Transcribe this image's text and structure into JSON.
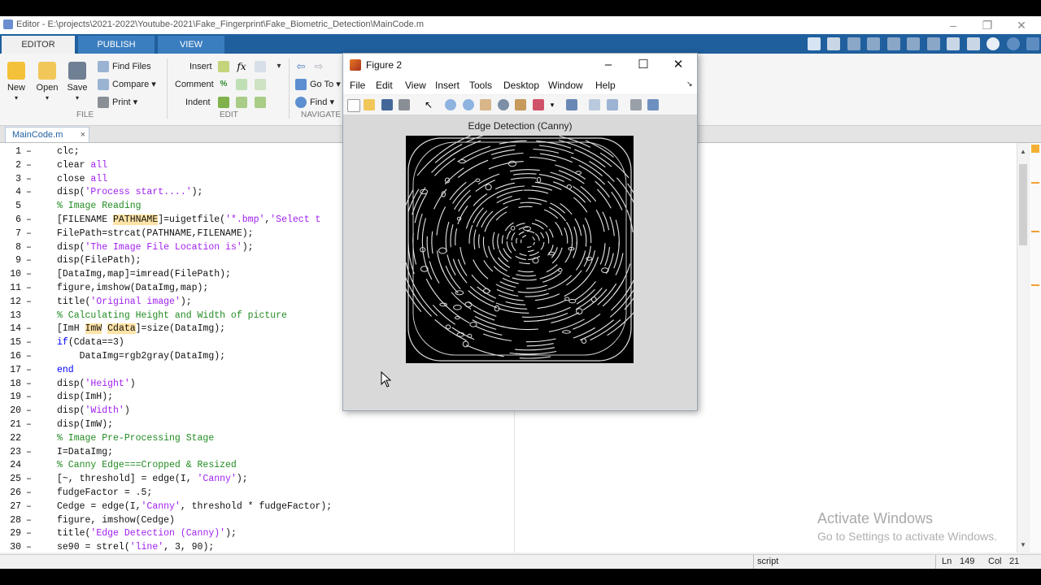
{
  "window": {
    "title": "Editor - E:\\projects\\2021-2022\\Youtube-2021\\Fake_Fingerprint\\Fake_Biometric_Detection\\MainCode.m"
  },
  "ribbon_tabs": [
    "EDITOR",
    "PUBLISH",
    "VIEW"
  ],
  "ribbon": {
    "file": {
      "new": "New",
      "open": "Open",
      "save": "Save",
      "find_files": "Find Files",
      "compare": "Compare",
      "print": "Print",
      "section": "FILE"
    },
    "edit": {
      "insert": "Insert",
      "comment": "Comment",
      "indent": "Indent",
      "fx": "fx",
      "section": "EDIT"
    },
    "navigate": {
      "goto": "Go To",
      "find": "Find",
      "section": "NAVIGATE"
    }
  },
  "file_tab": {
    "name": "MainCode.m",
    "close": "×"
  },
  "code_lines": [
    {
      "n": "1",
      "d": "–",
      "html": "clc;"
    },
    {
      "n": "2",
      "d": "–",
      "html": "clear <span class='str'>all</span>"
    },
    {
      "n": "3",
      "d": "–",
      "html": "close <span class='str'>all</span>"
    },
    {
      "n": "4",
      "d": "–",
      "html": "disp(<span class='str'>'Process start....'</span>);"
    },
    {
      "n": "5",
      "d": "",
      "html": "<span class='cm'>% Image Reading</span>"
    },
    {
      "n": "6",
      "d": "–",
      "html": "[FILENAME <span class='hl'>PATHNAME</span>]=uigetfile(<span class='str'>'*.bmp'</span>,<span class='str'>'Select t</span>"
    },
    {
      "n": "7",
      "d": "–",
      "html": "FilePath=strcat(PATHNAME,FILENAME);"
    },
    {
      "n": "8",
      "d": "–",
      "html": "disp(<span class='str'>'The Image File Location is'</span>);"
    },
    {
      "n": "9",
      "d": "–",
      "html": "disp(FilePath);"
    },
    {
      "n": "10",
      "d": "–",
      "html": "[DataImg,map]=imread(FilePath);"
    },
    {
      "n": "11",
      "d": "–",
      "html": "figure,imshow(DataImg,map);"
    },
    {
      "n": "12",
      "d": "–",
      "html": "title(<span class='str'>'Original image'</span>);"
    },
    {
      "n": "13",
      "d": "",
      "html": "<span class='cm'>% Calculating Height and Width of picture</span>"
    },
    {
      "n": "14",
      "d": "–",
      "html": "[ImH <span class='hl'>ImW</span> <span class='hl'>Cdata</span>]=size(DataImg);"
    },
    {
      "n": "15",
      "d": "–",
      "html": "<span class='kw'>if</span>(Cdata==3)"
    },
    {
      "n": "16",
      "d": "–",
      "html": "    DataImg=rgb2gray(DataImg);"
    },
    {
      "n": "17",
      "d": "–",
      "html": "<span class='kw'>end</span>"
    },
    {
      "n": "18",
      "d": "–",
      "html": "disp(<span class='str'>'Height'</span>)"
    },
    {
      "n": "19",
      "d": "–",
      "html": "disp(ImH);"
    },
    {
      "n": "20",
      "d": "–",
      "html": "disp(<span class='str'>'Width'</span>)"
    },
    {
      "n": "21",
      "d": "–",
      "html": "disp(ImW);"
    },
    {
      "n": "22",
      "d": "",
      "html": "<span class='cm'>% Image Pre-Processing Stage</span>"
    },
    {
      "n": "23",
      "d": "–",
      "html": "I=DataImg;"
    },
    {
      "n": "24",
      "d": "",
      "html": "<span class='cm'>% Canny Edge===Cropped &amp; Resized</span>"
    },
    {
      "n": "25",
      "d": "–",
      "html": "[~, threshold] = edge(I, <span class='str'>'Canny'</span>);"
    },
    {
      "n": "26",
      "d": "–",
      "html": "fudgeFactor = .5;"
    },
    {
      "n": "27",
      "d": "–",
      "html": "Cedge = edge(I,<span class='str'>'Canny'</span>, threshold * fudgeFactor);"
    },
    {
      "n": "28",
      "d": "–",
      "html": "figure, imshow(Cedge)"
    },
    {
      "n": "29",
      "d": "–",
      "html": "title(<span class='str'>'Edge Detection (Canny)'</span>);"
    },
    {
      "n": "30",
      "d": "–",
      "html": "se90 = strel(<span class='str'>'line'</span>, 3, 90);"
    }
  ],
  "figure": {
    "title": "Figure 2",
    "menu": [
      "File",
      "Edit",
      "View",
      "Insert",
      "Tools",
      "Desktop",
      "Window",
      "Help"
    ],
    "axes_title": "Edge Detection (Canny)"
  },
  "watermark": {
    "line1": "Activate Windows",
    "line2": "Go to Settings to activate Windows."
  },
  "status": {
    "mode": "script",
    "ln_label": "Ln",
    "ln": "149",
    "col_label": "Col",
    "col": "21"
  }
}
